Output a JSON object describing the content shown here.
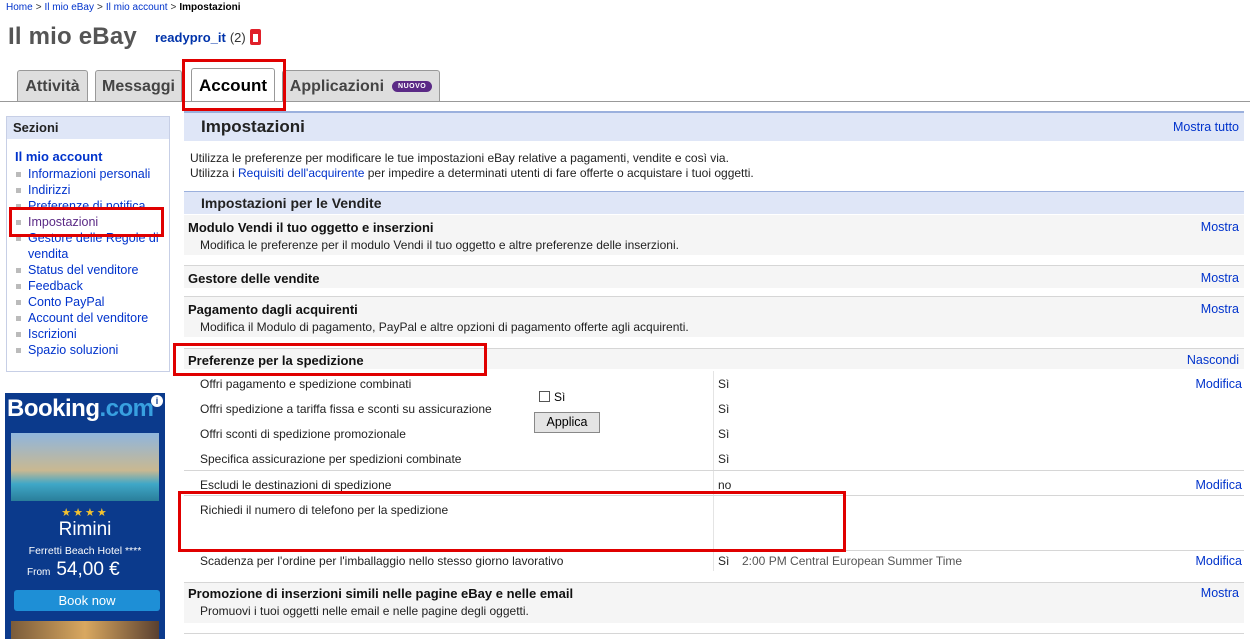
{
  "breadcrumb": {
    "items": [
      "Home",
      "Il mio eBay",
      "Il mio account"
    ],
    "current": "Impostazioni",
    "separator": ">"
  },
  "header": {
    "title": "Il mio eBay",
    "username": "readypro_it",
    "feedback": "(2)"
  },
  "tabs": [
    {
      "label": "Attività"
    },
    {
      "label": "Messaggi"
    },
    {
      "label": "Account"
    },
    {
      "label": "Applicazioni",
      "badge": "NUOVO"
    }
  ],
  "sidebar": {
    "title": "Sezioni",
    "subtitle": "Il mio account",
    "items": [
      {
        "label": "Informazioni personali"
      },
      {
        "label": "Indirizzi"
      },
      {
        "label": "Preferenze di notifica"
      },
      {
        "label": "Impostazioni"
      },
      {
        "label": "Gestore delle Regole di vendita"
      },
      {
        "label": "Status del venditore"
      },
      {
        "label": "Feedback"
      },
      {
        "label": "Conto PayPal"
      },
      {
        "label": "Account del venditore"
      },
      {
        "label": "Iscrizioni"
      },
      {
        "label": "Spazio soluzioni"
      }
    ]
  },
  "ad": {
    "logo": "Booking",
    "logo_suffix": ".com",
    "stars": "★★★★",
    "city": "Rimini",
    "hotel": "Ferretti Beach Hotel ****",
    "from": "From",
    "price": "54,00 €",
    "button": "Book now"
  },
  "main": {
    "title": "Impostazioni",
    "show_all": "Mostra tutto",
    "intro_line1": "Utilizza le preferenze per modificare le tue impostazioni eBay relative a pagamenti, vendite e così via.",
    "intro_line2_pre": "Utilizza i ",
    "intro_line2_link": "Requisiti dell'acquirente",
    "intro_line2_post": " per impedire a determinati utenti di fare offerte o acquistare i tuoi oggetti.",
    "section_title": "Impostazioni per le Vendite",
    "rows": [
      {
        "title": "Modulo Vendi il tuo oggetto e inserzioni",
        "desc": "Modifica le preferenze per il modulo Vendi il tuo oggetto e altre preferenze delle inserzioni.",
        "action": "Mostra"
      },
      {
        "title": "Gestore delle vendite",
        "desc": "",
        "action": "Mostra"
      },
      {
        "title": "Pagamento dagli acquirenti",
        "desc": "Modifica il Modulo di pagamento, PayPal e altre opzioni di pagamento offerte agli acquirenti.",
        "action": "Mostra"
      }
    ],
    "shipping": {
      "title": "Preferenze per la spedizione",
      "action": "Nascondi",
      "prefs": [
        {
          "label": "Offri pagamento e spedizione combinati",
          "value": "Sì",
          "action": "Modifica"
        },
        {
          "label": "Offri spedizione a tariffa fissa e sconti su assicurazione",
          "value": "Sì"
        },
        {
          "label": "Offri sconti di spedizione promozionale",
          "value": "Sì"
        },
        {
          "label": "Specifica assicurazione per spedizioni combinate",
          "value": "Sì"
        },
        {
          "label": "Escludi le destinazioni di spedizione",
          "value": "no",
          "action": "Modifica"
        },
        {
          "label": "Richiedi il numero di telefono per la spedizione",
          "checkbox_label": "Sì",
          "button": "Applica"
        },
        {
          "label": "Scadenza per l'ordine per l'imballaggio nello stesso giorno lavorativo",
          "value": "Sì",
          "extra": "2:00 PM Central European Summer Time",
          "action": "Modifica"
        }
      ]
    },
    "promo": {
      "title": "Promozione di inserzioni simili nelle pagine eBay e nelle email",
      "desc": "Promuovi i tuoi oggetti nelle email e nelle pagine degli oggetti.",
      "action": "Mostra"
    }
  },
  "colors": {
    "link": "#0033cc",
    "highlight": "#e00000",
    "header_bg": "#dfe6f7",
    "badge": "#5b2a86"
  }
}
